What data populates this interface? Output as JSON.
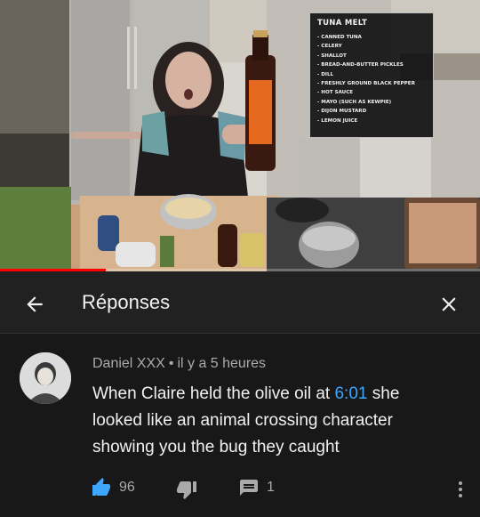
{
  "video": {
    "recipe_card": {
      "title": "TUNA MELT",
      "items": [
        "- CANNED TUNA",
        "- CELERY",
        "- SHALLOT",
        "- BREAD-AND-BUTTER PICKLES",
        "- DILL",
        "- FRESHLY GROUND BLACK PEPPER",
        "- HOT SAUCE",
        "- MAYO (SUCH AS KEWPIE)",
        "- DIJON MUSTARD",
        "- LEMON JUICE"
      ]
    },
    "progress_fraction": 0.22,
    "progress_color": "#ff0000"
  },
  "header": {
    "title": "Réponses",
    "back_icon": "arrow-left-icon",
    "close_icon": "close-icon"
  },
  "reply": {
    "author": "Daniel XXX",
    "separator": "•",
    "time": "il y a 5 heures",
    "text_before": "When Claire held the olive oil at ",
    "timestamp": "6:01",
    "text_after": " she looked like an animal crossing character showing you the bug they caught",
    "likes": "96",
    "replies": "1",
    "like_color": "#3ea6ff",
    "timestamp_color": "#3ea6ff"
  }
}
